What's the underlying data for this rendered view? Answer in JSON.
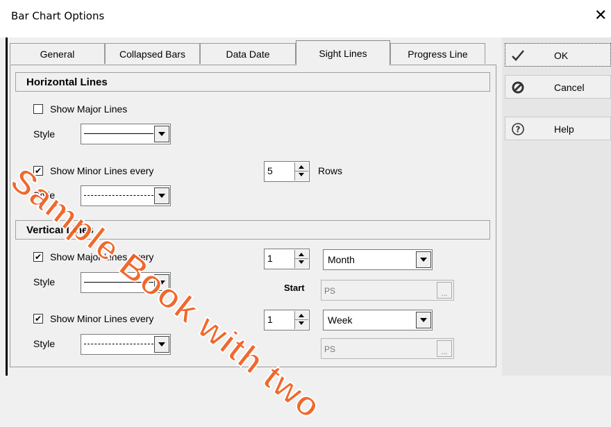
{
  "window": {
    "title": "Bar Chart Options",
    "close_glyph": "✕"
  },
  "tabs": [
    {
      "label": "General"
    },
    {
      "label": "Collapsed Bars"
    },
    {
      "label": "Data Date"
    },
    {
      "label": "Sight Lines",
      "active": true
    },
    {
      "label": "Progress Line"
    }
  ],
  "buttons": {
    "ok": "OK",
    "cancel": "Cancel",
    "help": "Help"
  },
  "horizontal": {
    "title": "Horizontal Lines",
    "major": {
      "label": "Show Major Lines",
      "checked": false,
      "style_label": "Style",
      "style": "solid"
    },
    "minor": {
      "label": "Show Minor Lines every",
      "checked": true,
      "value": "5",
      "unit": "Rows",
      "style_label": "Style",
      "style": "dashed"
    }
  },
  "vertical": {
    "title": "Vertical Lines",
    "major": {
      "label": "Show Major Lines every",
      "checked": true,
      "value": "1",
      "unit": "Month",
      "style_label": "Style",
      "style": "solid",
      "start_label": "Start",
      "start_value": "PS",
      "dots": "..."
    },
    "minor": {
      "label": "Show Minor Lines every",
      "checked": true,
      "value": "1",
      "unit": "Week",
      "style_label": "Style",
      "style": "dashed",
      "start_value": "PS",
      "dots": "..."
    }
  },
  "check_glyph": "✔",
  "watermark": "Sample Book with two",
  "colors": {
    "watermark": "#f05f1e",
    "dialog_bg": "#f0f0f0"
  },
  "icons": {
    "ok": "checkmark-icon",
    "cancel": "cancel-icon",
    "help": "help-icon"
  }
}
